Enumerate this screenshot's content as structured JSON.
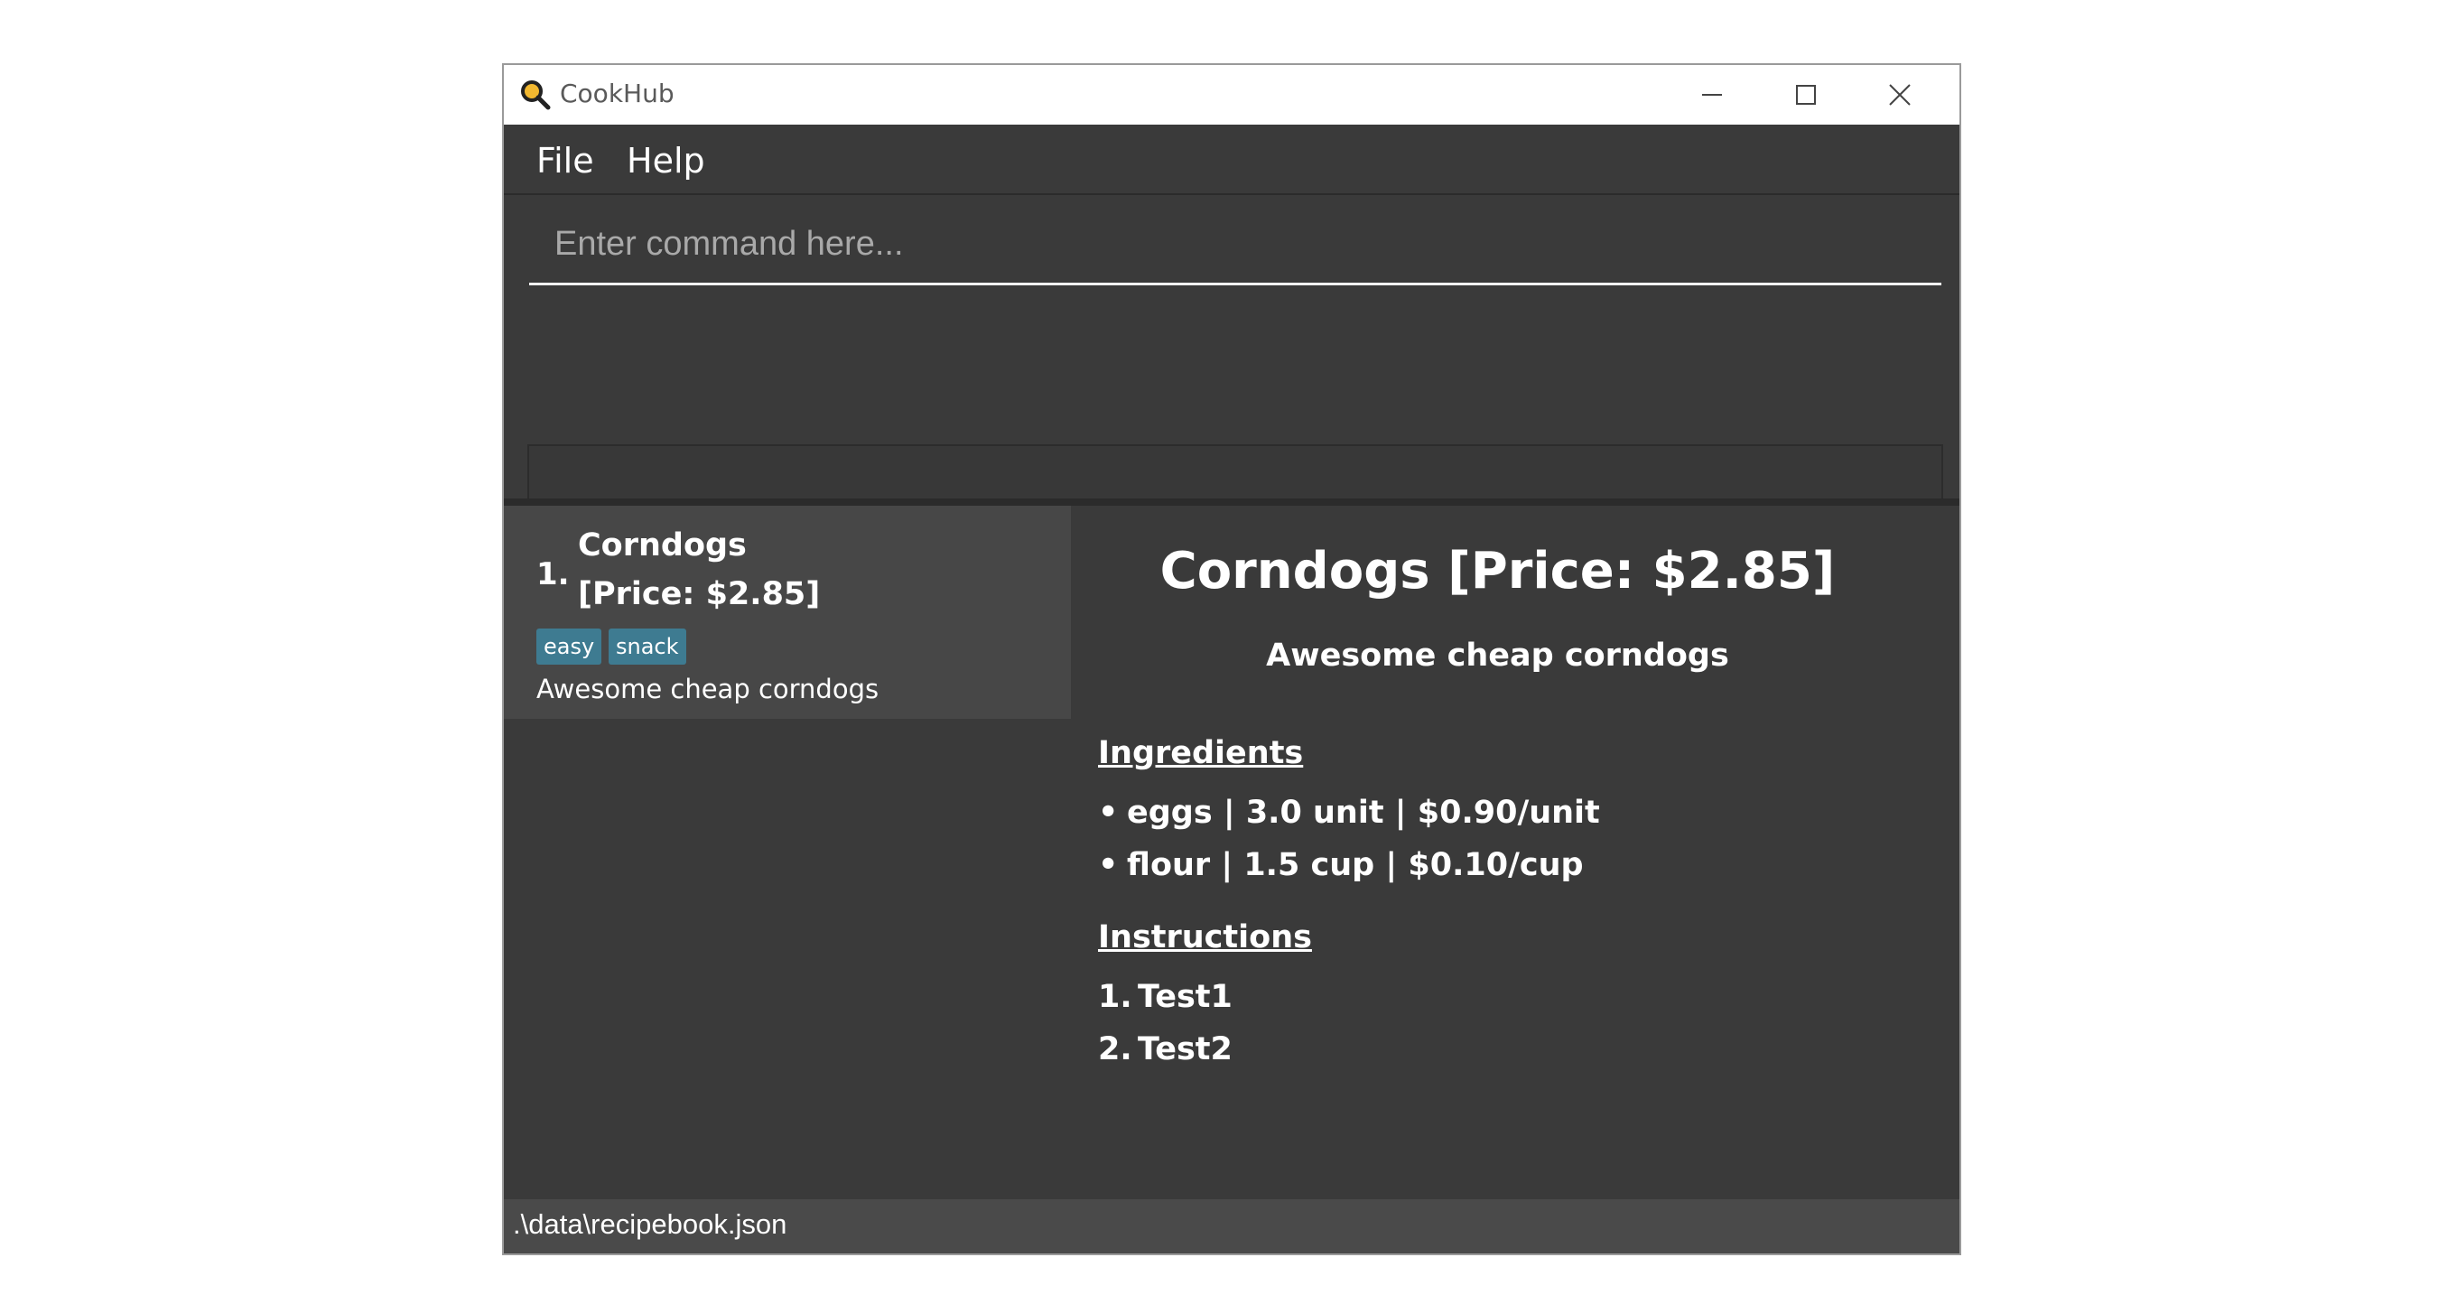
{
  "window": {
    "title": "CookHub"
  },
  "menu": {
    "items": [
      "File",
      "Help"
    ]
  },
  "command": {
    "placeholder": "Enter command here...",
    "value": ""
  },
  "result_display": {
    "text": ""
  },
  "recipe_list": [
    {
      "index": "1.",
      "name": "Corndogs",
      "price": "[Price: $2.85]",
      "tags": [
        "easy",
        "snack"
      ],
      "description": "Awesome cheap corndogs"
    }
  ],
  "detail": {
    "title": "Corndogs [Price: $2.85]",
    "description": "Awesome cheap corndogs",
    "ingredients_heading": "Ingredients",
    "ingredients": [
      "eggs | 3.0 unit | $0.90/unit",
      "flour | 1.5 cup | $0.10/cup"
    ],
    "instructions_heading": "Instructions",
    "instructions": [
      {
        "num": "1.",
        "text": "Test1"
      },
      {
        "num": "2.",
        "text": "Test2"
      }
    ]
  },
  "status_bar": {
    "path": ".\\data\\recipebook.json"
  },
  "colors": {
    "background": "#3a3a3a",
    "tag": "#3e7b91",
    "status_bar": "#4a4a4a",
    "selected_card": "#474747"
  },
  "icons": {
    "app": "magnifier-icon",
    "minimize": "minimize-icon",
    "maximize": "maximize-icon",
    "close": "close-icon"
  }
}
